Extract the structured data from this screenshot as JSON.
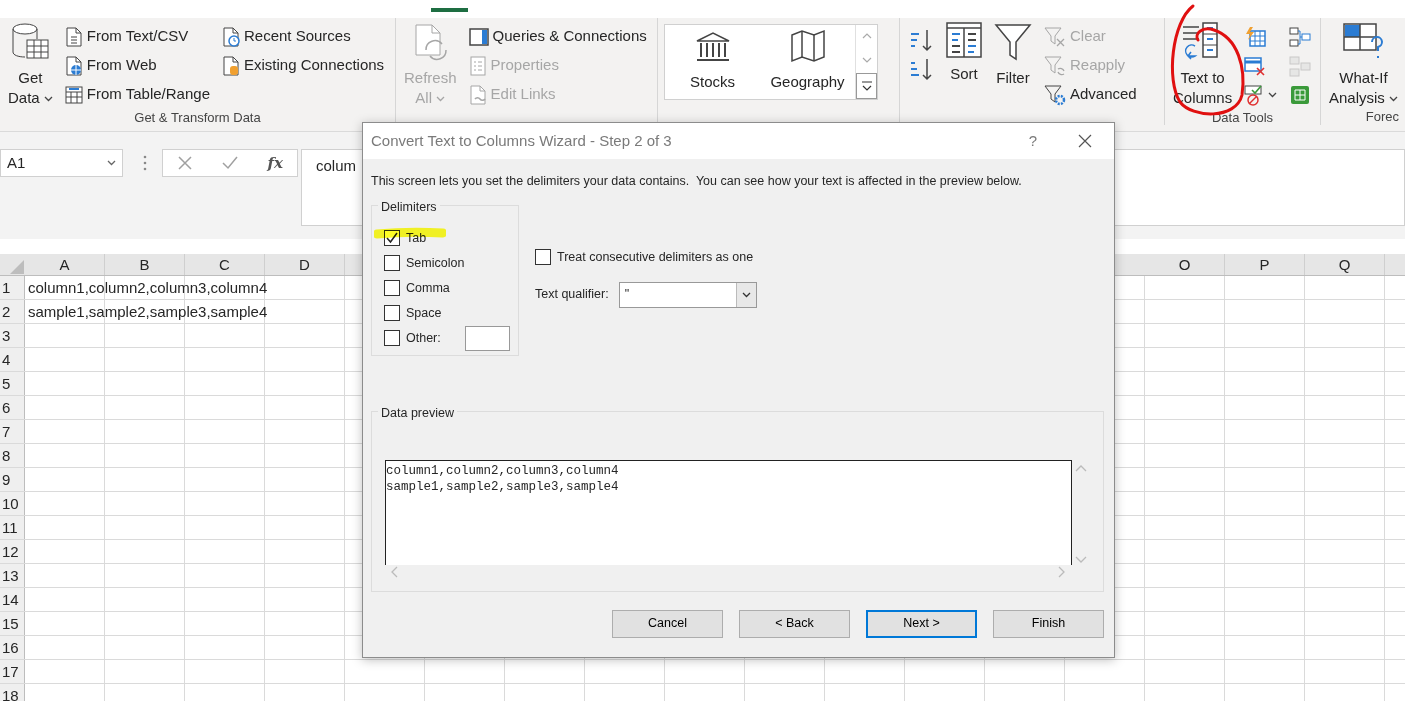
{
  "ribbon": {
    "groups": [
      {
        "label": "Get & Transform Data",
        "items": [
          {
            "kind": "large",
            "lines": [
              "Get",
              "Data"
            ],
            "menu": true,
            "disabled": false
          },
          {
            "kind": "stack",
            "items": [
              {
                "kind": "small",
                "label": "From Text/CSV",
                "disabled": false
              },
              {
                "kind": "small",
                "label": "From Web",
                "disabled": false
              },
              {
                "kind": "small",
                "label": "From Table/Range",
                "disabled": false
              }
            ]
          },
          {
            "kind": "stack",
            "items": [
              {
                "kind": "small",
                "label": "Recent Sources",
                "disabled": false
              },
              {
                "kind": "small",
                "label": "Existing Connections",
                "disabled": false
              }
            ]
          }
        ]
      },
      {
        "items": [
          {
            "kind": "large",
            "lines": [
              "Refresh",
              "All"
            ],
            "menu": true,
            "disabled": true
          },
          {
            "kind": "stack",
            "items": [
              {
                "kind": "small",
                "label": "Queries & Connections",
                "disabled": false
              },
              {
                "kind": "small",
                "label": "Properties",
                "disabled": true
              },
              {
                "kind": "small",
                "label": "Edit Links",
                "disabled": true
              }
            ]
          }
        ]
      },
      {
        "items": [
          {
            "kind": "gallery",
            "items": [
              {
                "label": "Stocks"
              },
              {
                "label": "Geography"
              }
            ]
          }
        ]
      },
      {
        "items": [
          {
            "kind": "stack",
            "items": [
              {
                "kind": "icon",
                "disabled": false
              },
              {
                "kind": "icon",
                "disabled": false
              }
            ]
          },
          {
            "kind": "large",
            "lines": [
              "Sort"
            ],
            "menu": false,
            "disabled": false
          },
          {
            "kind": "large",
            "lines": [
              "Filter"
            ],
            "menu": false,
            "disabled": false
          },
          {
            "kind": "stack",
            "items": [
              {
                "kind": "small",
                "label": "Clear",
                "disabled": true
              },
              {
                "kind": "small",
                "label": "Reapply",
                "disabled": true
              },
              {
                "kind": "small",
                "label": "Advanced",
                "disabled": false
              }
            ]
          }
        ]
      },
      {
        "label": "Data Tools",
        "items": [
          {
            "kind": "large",
            "lines": [
              "Text to",
              "Columns"
            ],
            "menu": false,
            "disabled": false
          },
          {
            "kind": "stack",
            "items": [
              {
                "kind": "icon",
                "disabled": false
              },
              {
                "kind": "icon",
                "disabled": false
              },
              {
                "kind": "icon",
                "disabled": false,
                "menu": true
              }
            ]
          },
          {
            "kind": "stack",
            "items": [
              {
                "kind": "icon",
                "disabled": false
              },
              {
                "kind": "icon",
                "disabled": true
              },
              {
                "kind": "icon",
                "disabled": false
              }
            ]
          }
        ]
      },
      {
        "label": "Forec",
        "items": [
          {
            "kind": "large",
            "lines": [
              "What-If",
              "Analysis"
            ],
            "menu": true,
            "disabled": false
          }
        ]
      }
    ]
  },
  "formula_bar": {
    "name_box": "A1",
    "function_label": "fx",
    "content": "colum"
  },
  "sheet": {
    "column_headers": [
      [
        "A",
        "B",
        "C",
        "D"
      ],
      [
        "O",
        "P",
        "Q"
      ]
    ],
    "rows": [
      {
        "number": "1",
        "text": "column1,column2,column3,column4"
      },
      {
        "number": "2",
        "text": "sample1,sample2,sample3,sample4"
      },
      {
        "number": "3"
      },
      {
        "number": "4"
      },
      {
        "number": "5"
      },
      {
        "number": "6"
      },
      {
        "number": "7"
      },
      {
        "number": "8"
      },
      {
        "number": "9"
      },
      {
        "number": "10"
      },
      {
        "number": "11"
      },
      {
        "number": "12"
      },
      {
        "number": "13"
      },
      {
        "number": "14"
      },
      {
        "number": "15"
      },
      {
        "number": "16"
      },
      {
        "number": "17"
      },
      {
        "number": "18"
      }
    ]
  },
  "dialog": {
    "title": "Convert Text to Columns Wizard - Step 2 of 3",
    "help_button": "?",
    "intro": "This screen lets you set the delimiters your data contains.  You can see how your text is affected in the preview below.",
    "delimiters": {
      "legend": "Delimiters",
      "options": [
        {
          "kind": "checkbox",
          "label": "Tab",
          "checked": true
        },
        {
          "kind": "checkbox",
          "label": "Semicolon",
          "checked": false
        },
        {
          "kind": "checkbox",
          "label": "Comma",
          "checked": false
        },
        {
          "kind": "checkbox",
          "label": "Space",
          "checked": false
        },
        {
          "kind": "other",
          "label": "Other:",
          "checked": false
        }
      ]
    },
    "consecutive": {
      "label": "Treat consecutive delimiters as one",
      "checked": false
    },
    "qualifier": {
      "label": "Text qualifier:",
      "value": "\""
    },
    "preview": {
      "legend": "Data preview",
      "lines": [
        "column1,column2,column3,column4",
        "sample1,sample2,sample3,sample4"
      ]
    },
    "buttons": [
      {
        "label": "Cancel",
        "default": false
      },
      {
        "label": "< Back",
        "default": false
      },
      {
        "label": "Next >",
        "default": true
      },
      {
        "label": "Finish",
        "default": false
      }
    ]
  }
}
